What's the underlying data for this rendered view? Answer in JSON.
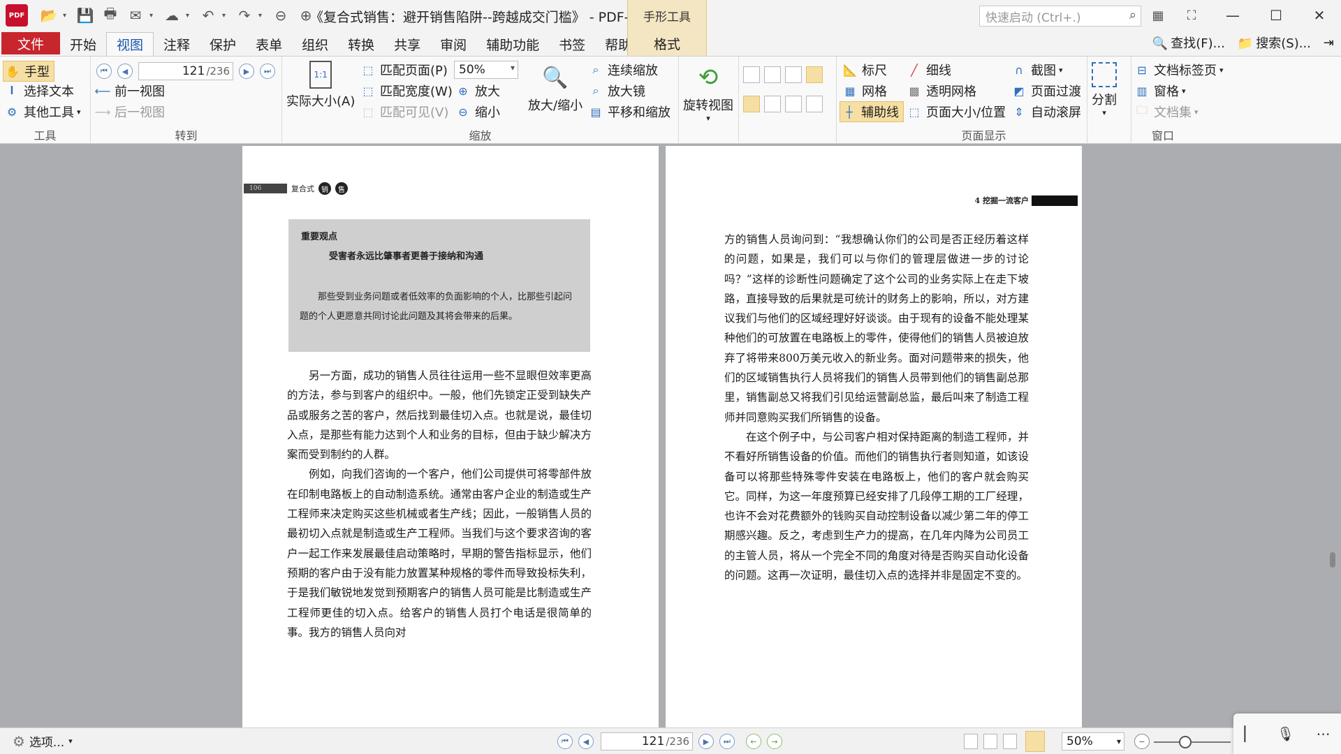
{
  "titlebar": {
    "title": "《复合式销售：避开销售陷阱--跨越成交门槛》 - PDF-...",
    "context_tab_header": "手形工具",
    "quick_launch_placeholder": "快速启动 (Ctrl+.)"
  },
  "menu": {
    "file": "文件",
    "tabs": [
      "开始",
      "视图",
      "注释",
      "保护",
      "表单",
      "组织",
      "转换",
      "共享",
      "审阅",
      "辅助功能",
      "书签",
      "帮助"
    ],
    "active_tab": "视图",
    "format_tab": "格式",
    "find": "查找(F)...",
    "search": "搜索(S)..."
  },
  "ribbon": {
    "tools": {
      "label": "工具",
      "hand": "手型",
      "select_text": "选择文本",
      "other_tools": "其他工具"
    },
    "goto": {
      "label": "转到",
      "page_current": "121",
      "page_total": "/236",
      "prev_view": "前一视图",
      "next_view": "后一视图"
    },
    "zoom": {
      "label": "缩放",
      "actual_size": "实际大小(A)",
      "fit_page": "匹配页面(P)",
      "fit_width": "匹配宽度(W)",
      "fit_visible": "匹配可见(V)",
      "zoom_value": "50%",
      "zoom_in": "放大",
      "zoom_out": "缩小",
      "zoom_inout": "放大/缩小",
      "continuous_zoom": "连续缩放",
      "magnifier": "放大镜",
      "pan_zoom": "平移和缩放"
    },
    "rotate": {
      "label": "旋转视图"
    },
    "page_display": {
      "label": "页面显示",
      "ruler": "标尺",
      "lineweight": "细线",
      "grid": "网格",
      "transparent_grid": "透明网格",
      "guides": "辅助线",
      "page_size": "页面大小/位置",
      "snapshot": "截图",
      "page_transition": "页面过渡",
      "auto_scroll": "自动滚屏",
      "split": "分割"
    },
    "window": {
      "label": "窗口",
      "doc_tabs": "文档标签页",
      "panes": "窗格",
      "doc_set": "文档集"
    }
  },
  "document": {
    "left_page": {
      "page_number_header": "106",
      "header_title": "复合式",
      "header_circles": [
        "销",
        "售"
      ],
      "quote_title": "重要观点",
      "quote_subtitle": "受害者永远比肇事者更善于接纳和沟通",
      "quote_body": "那些受到业务问题或者低效率的负面影响的个人，比那些引起问题的个人更愿意共同讨论此问题及其将会带来的后果。",
      "paragraphs": [
        "另一方面，成功的销售人员往往运用一些不显眼但效率更高的方法，参与到客户的组织中。一般，他们先锁定正受到缺失产品或服务之苦的客户，然后找到最佳切入点。也就是说，最佳切入点，是那些有能力达到个人和业务的目标，但由于缺少解决方案而受到制约的人群。",
        "例如，向我们咨询的一个客户，他们公司提供可将零部件放在印制电路板上的自动制造系统。通常由客户企业的制造或生产工程师来决定购买这些机械或者生产线；因此，一般销售人员的最初切入点就是制造或生产工程师。当我们与这个要求咨询的客户一起工作来发展最佳启动策略时，早期的警告指标显示，他们预期的客户由于没有能力放置某种规格的零件而导致投标失利，于是我们敏锐地发觉到预期客户的销售人员可能是比制造或生产工程师更佳的切入点。给客户的销售人员打个电话是很简单的事。我方的销售人员向对"
      ]
    },
    "right_page": {
      "header_title": "4  挖掘一流客户",
      "paragraphs": [
        "方的销售人员询问到：“我想确认你们的公司是否正经历着这样的问题，如果是，我们可以与你们的管理层做进一步的讨论吗？”这样的诊断性问题确定了这个公司的业务实际上在走下坡路，直接导致的后果就是可统计的财务上的影响，所以，对方建议我们与他们的区域经理好好谈谈。由于现有的设备不能处理某种他们的可放置在电路板上的零件，使得他们的销售人员被迫放弃了将带来800万美元收入的新业务。面对问题带来的损失，他们的区域销售执行人员将我们的销售人员带到他们的销售副总那里，销售副总又将我们引见给运营副总监，最后叫来了制造工程师并同意购买我们所销售的设备。",
        "在这个例子中，与公司客户相对保持距离的制造工程师，并不看好所销售设备的价值。而他们的销售执行者则知道，如该设备可以将那些特殊零件安装在电路板上，他们的客户就会购买它。同样，为这一年度预算已经安排了几段停工期的工厂经理，也许不会对花费额外的钱购买自动控制设备以减少第二年的停工期感兴趣。反之，考虑到生产力的提高，在几年内降为公司员工的主管人员，将从一个完全不同的角度对待是否购买自动化设备的问题。这再一次证明，最佳切入点的选择并非是固定不变的。"
      ]
    }
  },
  "statusbar": {
    "options": "选项...",
    "page_current": "121",
    "page_total": "/236",
    "zoom_value": "50%",
    "zoom_level": 0.5
  }
}
